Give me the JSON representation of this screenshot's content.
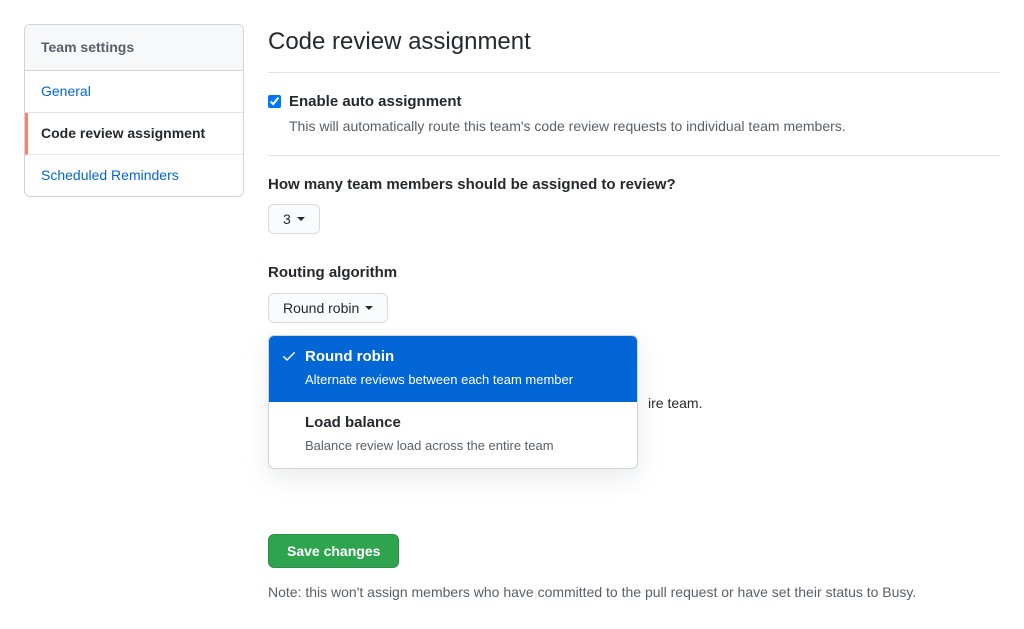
{
  "sidebar": {
    "header": "Team settings",
    "items": [
      {
        "label": "General"
      },
      {
        "label": "Code review assignment"
      },
      {
        "label": "Scheduled Reminders"
      }
    ]
  },
  "main": {
    "title": "Code review assignment",
    "enable": {
      "label": "Enable auto assignment",
      "desc": "This will automatically route this team's code review requests to individual team members."
    },
    "count": {
      "label": "How many team members should be assigned to review?",
      "value": "3"
    },
    "routing": {
      "label": "Routing algorithm",
      "selected": "Round robin",
      "options": [
        {
          "title": "Round robin",
          "desc": "Alternate reviews between each team member"
        },
        {
          "title": "Load balance",
          "desc": "Balance review load across the entire team"
        }
      ]
    },
    "obscured_fragment": "ire team.",
    "save_label": "Save changes",
    "note": "Note: this won't assign members who have committed to the pull request or have set their status to Busy."
  }
}
